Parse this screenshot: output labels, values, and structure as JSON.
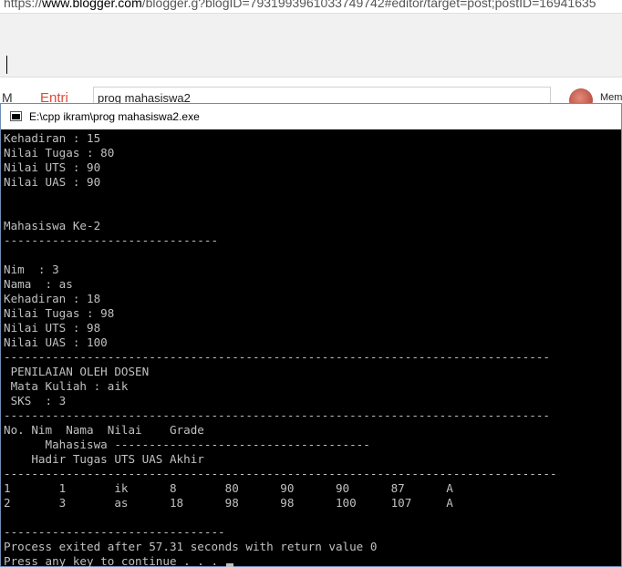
{
  "browser": {
    "url_prefix": "https://",
    "url_domain": "www.blogger.com",
    "url_rest": "/blogger.g?blogID=7931993961033749742#editor/target=post;postID=16941635",
    "nav_label": "M",
    "entries_label": "Entri",
    "post_title": "prog mahasiswa2",
    "member_label": "Mem"
  },
  "console": {
    "title": "E:\\cpp ikram\\prog mahasiswa2.exe",
    "output": "Kehadiran : 15\nNilai Tugas : 80\nNilai UTS : 90\nNilai UAS : 90\n\n\nMahasiswa Ke-2\n-------------------------------\n\nNim  : 3\nNama  : as\nKehadiran : 18\nNilai Tugas : 98\nNilai UTS : 98\nNilai UAS : 100\n-------------------------------------------------------------------------------\n PENILAIAN OLEH DOSEN\n Mata Kuliah : aik\n SKS  : 3\n-------------------------------------------------------------------------------\nNo. Nim  Nama  Nilai    Grade\n      Mahasiswa -------------------------------------\n    Hadir Tugas UTS UAS Akhir\n--------------------------------------------------------------------------------\n1       1       ik      8       80      90      90      87      A\n2       3       as      18      98      98      100     107     A\n\n--------------------------------\nProcess exited after 57.31 seconds with return value 0\nPress any key to continue . . . "
  },
  "colors": {
    "console_bg": "#000000",
    "console_text": "#c0c0c0",
    "titlebar_bg": "#ffffff",
    "window_border": "#6d8fb2"
  }
}
